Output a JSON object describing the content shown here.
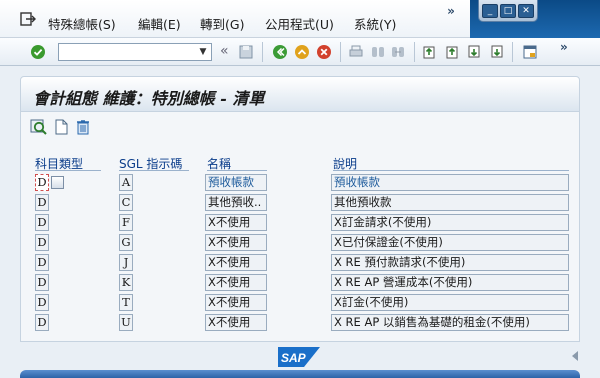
{
  "menu": {
    "items": [
      {
        "label": "特殊總帳(S)",
        "name": "menu-special-gl"
      },
      {
        "label": "編輯(E)",
        "name": "menu-edit"
      },
      {
        "label": "轉到(G)",
        "name": "menu-goto"
      },
      {
        "label": "公用程式(U)",
        "name": "menu-utilities"
      },
      {
        "label": "系統(Y)",
        "name": "menu-system"
      }
    ],
    "more": "»"
  },
  "toolbar": {
    "command_value": "",
    "back_chevron": "«",
    "more": "»"
  },
  "page": {
    "title": "會計組態 維護：特別總帳 - 清單"
  },
  "table": {
    "headers": [
      "科目類型",
      "SGL 指示碼",
      "名稱",
      "說明"
    ],
    "rows": [
      {
        "account_type": "D",
        "sgl": "A",
        "name": "預收帳款",
        "desc": "預收帳款"
      },
      {
        "account_type": "D",
        "sgl": "C",
        "name": "其他預收..",
        "desc": "其他預收款"
      },
      {
        "account_type": "D",
        "sgl": "F",
        "name": "X不使用",
        "desc": "X訂金請求(不使用)"
      },
      {
        "account_type": "D",
        "sgl": "G",
        "name": "X不使用",
        "desc": "X已付保證金(不使用)"
      },
      {
        "account_type": "D",
        "sgl": "J",
        "name": "X不使用",
        "desc": "X RE 預付款請求(不使用)"
      },
      {
        "account_type": "D",
        "sgl": "K",
        "name": "X不使用",
        "desc": "X  RE AP 營運成本(不使用)"
      },
      {
        "account_type": "D",
        "sgl": "T",
        "name": "X不使用",
        "desc": "X訂金(不使用)"
      },
      {
        "account_type": "D",
        "sgl": "U",
        "name": "X不使用",
        "desc": "X  RE AP 以銷售為基礎的租金(不使用)"
      }
    ]
  },
  "footer": {
    "logo_text": "SAP"
  },
  "colors": {
    "header_blue": "#0a3c8a",
    "sap_blue": "#1a6fc9",
    "frame_blue": "#0b4a86"
  }
}
